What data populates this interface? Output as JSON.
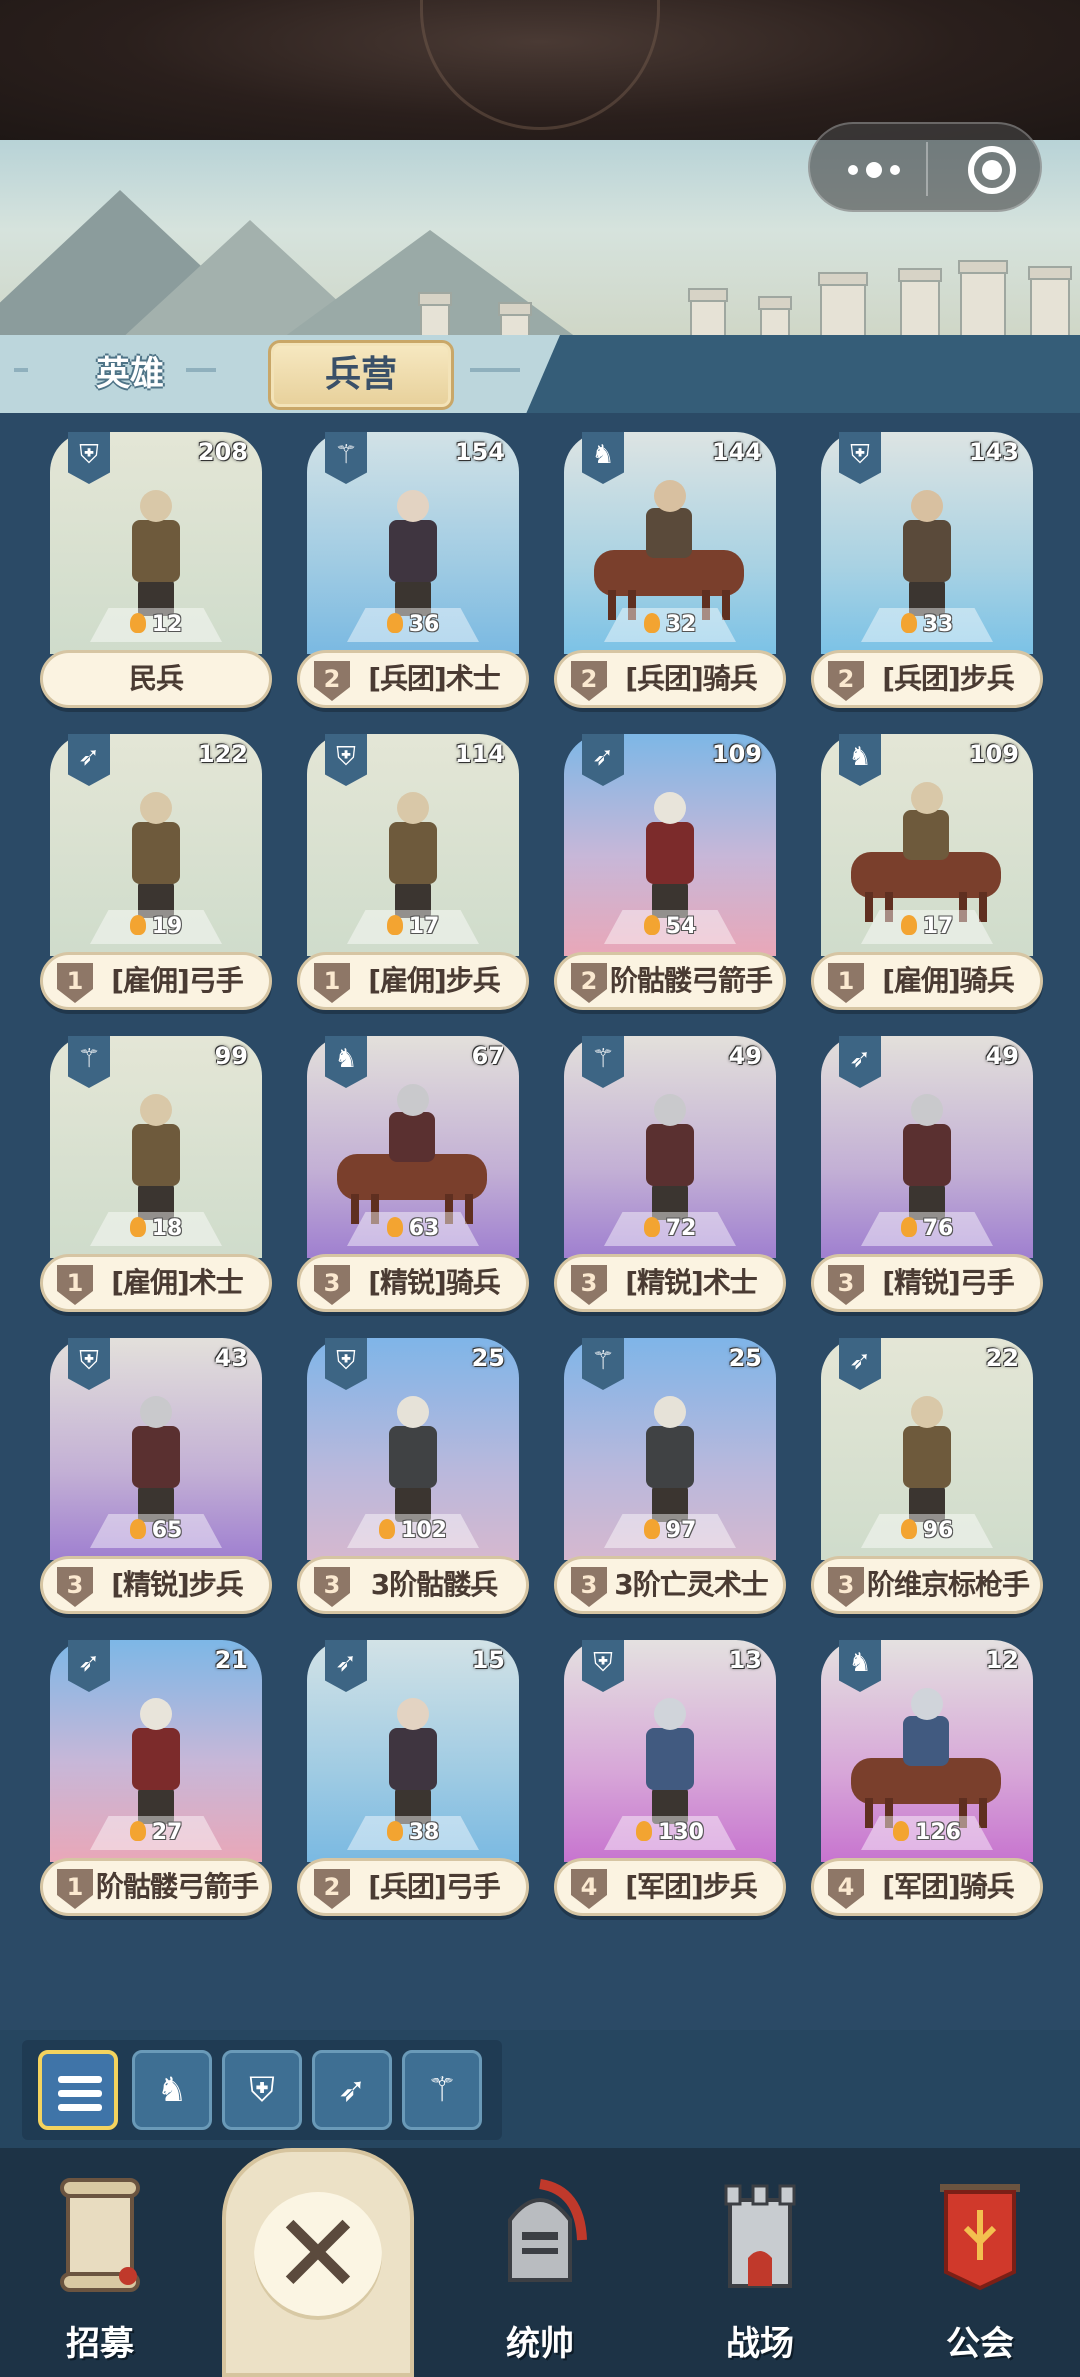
{
  "header": {
    "menu_icon": "more-dots-icon",
    "target_icon": "target-icon"
  },
  "tabs": {
    "hero": "英雄",
    "barracks": "兵营",
    "active": "兵营"
  },
  "cards": [
    {
      "name": "民兵",
      "tier": "",
      "count": "208",
      "power": "12",
      "type_icon": "shield-sword-icon",
      "bg": "sage",
      "mounted": false
    },
    {
      "name": "[兵团]术士",
      "tier": "2",
      "count": "154",
      "power": "36",
      "type_icon": "staff-icon",
      "bg": "blue",
      "mounted": false
    },
    {
      "name": "[兵团]骑兵",
      "tier": "2",
      "count": "144",
      "power": "32",
      "type_icon": "horse-icon",
      "bg": "skyblue",
      "mounted": true
    },
    {
      "name": "[兵团]步兵",
      "tier": "2",
      "count": "143",
      "power": "33",
      "type_icon": "shield-sword-icon",
      "bg": "skyblue",
      "mounted": false
    },
    {
      "name": "[雇佣]弓手",
      "tier": "1",
      "count": "122",
      "power": "19",
      "type_icon": "bow-icon",
      "bg": "sage",
      "mounted": false
    },
    {
      "name": "[雇佣]步兵",
      "tier": "1",
      "count": "114",
      "power": "17",
      "type_icon": "shield-sword-icon",
      "bg": "sage",
      "mounted": false
    },
    {
      "name": "阶骷髅弓箭手",
      "tier": "2",
      "count": "109",
      "power": "54",
      "type_icon": "bow-icon",
      "bg": "pink",
      "mounted": false
    },
    {
      "name": "[雇佣]骑兵",
      "tier": "1",
      "count": "109",
      "power": "17",
      "type_icon": "horse-icon",
      "bg": "sage",
      "mounted": true
    },
    {
      "name": "[雇佣]术士",
      "tier": "1",
      "count": "99",
      "power": "18",
      "type_icon": "staff-icon",
      "bg": "sage",
      "mounted": false
    },
    {
      "name": "[精锐]骑兵",
      "tier": "3",
      "count": "67",
      "power": "63",
      "type_icon": "horse-icon",
      "bg": "purple",
      "mounted": true
    },
    {
      "name": "[精锐]术士",
      "tier": "3",
      "count": "49",
      "power": "72",
      "type_icon": "staff-icon",
      "bg": "purple",
      "mounted": false
    },
    {
      "name": "[精锐]弓手",
      "tier": "3",
      "count": "49",
      "power": "76",
      "type_icon": "bow-icon",
      "bg": "purple",
      "mounted": false
    },
    {
      "name": "[精锐]步兵",
      "tier": "3",
      "count": "43",
      "power": "65",
      "type_icon": "shield-sword-icon",
      "bg": "purple",
      "mounted": false
    },
    {
      "name": "3阶骷髅兵",
      "tier": "3",
      "count": "25",
      "power": "102",
      "type_icon": "shield-sword-icon",
      "bg": "lavblue",
      "mounted": false
    },
    {
      "name": "3阶亡灵术士",
      "tier": "3",
      "count": "25",
      "power": "97",
      "type_icon": "staff-icon",
      "bg": "lavblue",
      "mounted": false
    },
    {
      "name": "阶维京标枪手",
      "tier": "3",
      "count": "22",
      "power": "96",
      "type_icon": "bow-icon",
      "bg": "sage",
      "mounted": false
    },
    {
      "name": "阶骷髅弓箭手",
      "tier": "1",
      "count": "21",
      "power": "27",
      "type_icon": "bow-icon",
      "bg": "pink",
      "mounted": false
    },
    {
      "name": "[兵团]弓手",
      "tier": "2",
      "count": "15",
      "power": "38",
      "type_icon": "bow-icon",
      "bg": "blue",
      "mounted": false
    },
    {
      "name": "[军团]步兵",
      "tier": "4",
      "count": "13",
      "power": "130",
      "type_icon": "shield-sword-icon",
      "bg": "magenta",
      "mounted": false
    },
    {
      "name": "[军团]骑兵",
      "tier": "4",
      "count": "12",
      "power": "126",
      "type_icon": "horse-icon",
      "bg": "magenta",
      "mounted": true
    }
  ],
  "filters": [
    {
      "icon": "list-icon",
      "active": true
    },
    {
      "icon": "horse-icon",
      "active": false
    },
    {
      "icon": "shield-sword-icon",
      "active": false
    },
    {
      "icon": "bow-icon",
      "active": false
    },
    {
      "icon": "staff-icon",
      "active": false
    }
  ],
  "nav": {
    "recruit": "招募",
    "close_icon": "close-icon",
    "commander": "统帅",
    "battlefield": "战场",
    "guild": "公会"
  },
  "colors": {
    "background": "#2b4a66",
    "nameplate": "#fbf3e1",
    "tab_active": "#f1dfb0",
    "accent_gold": "#f4d35e"
  }
}
